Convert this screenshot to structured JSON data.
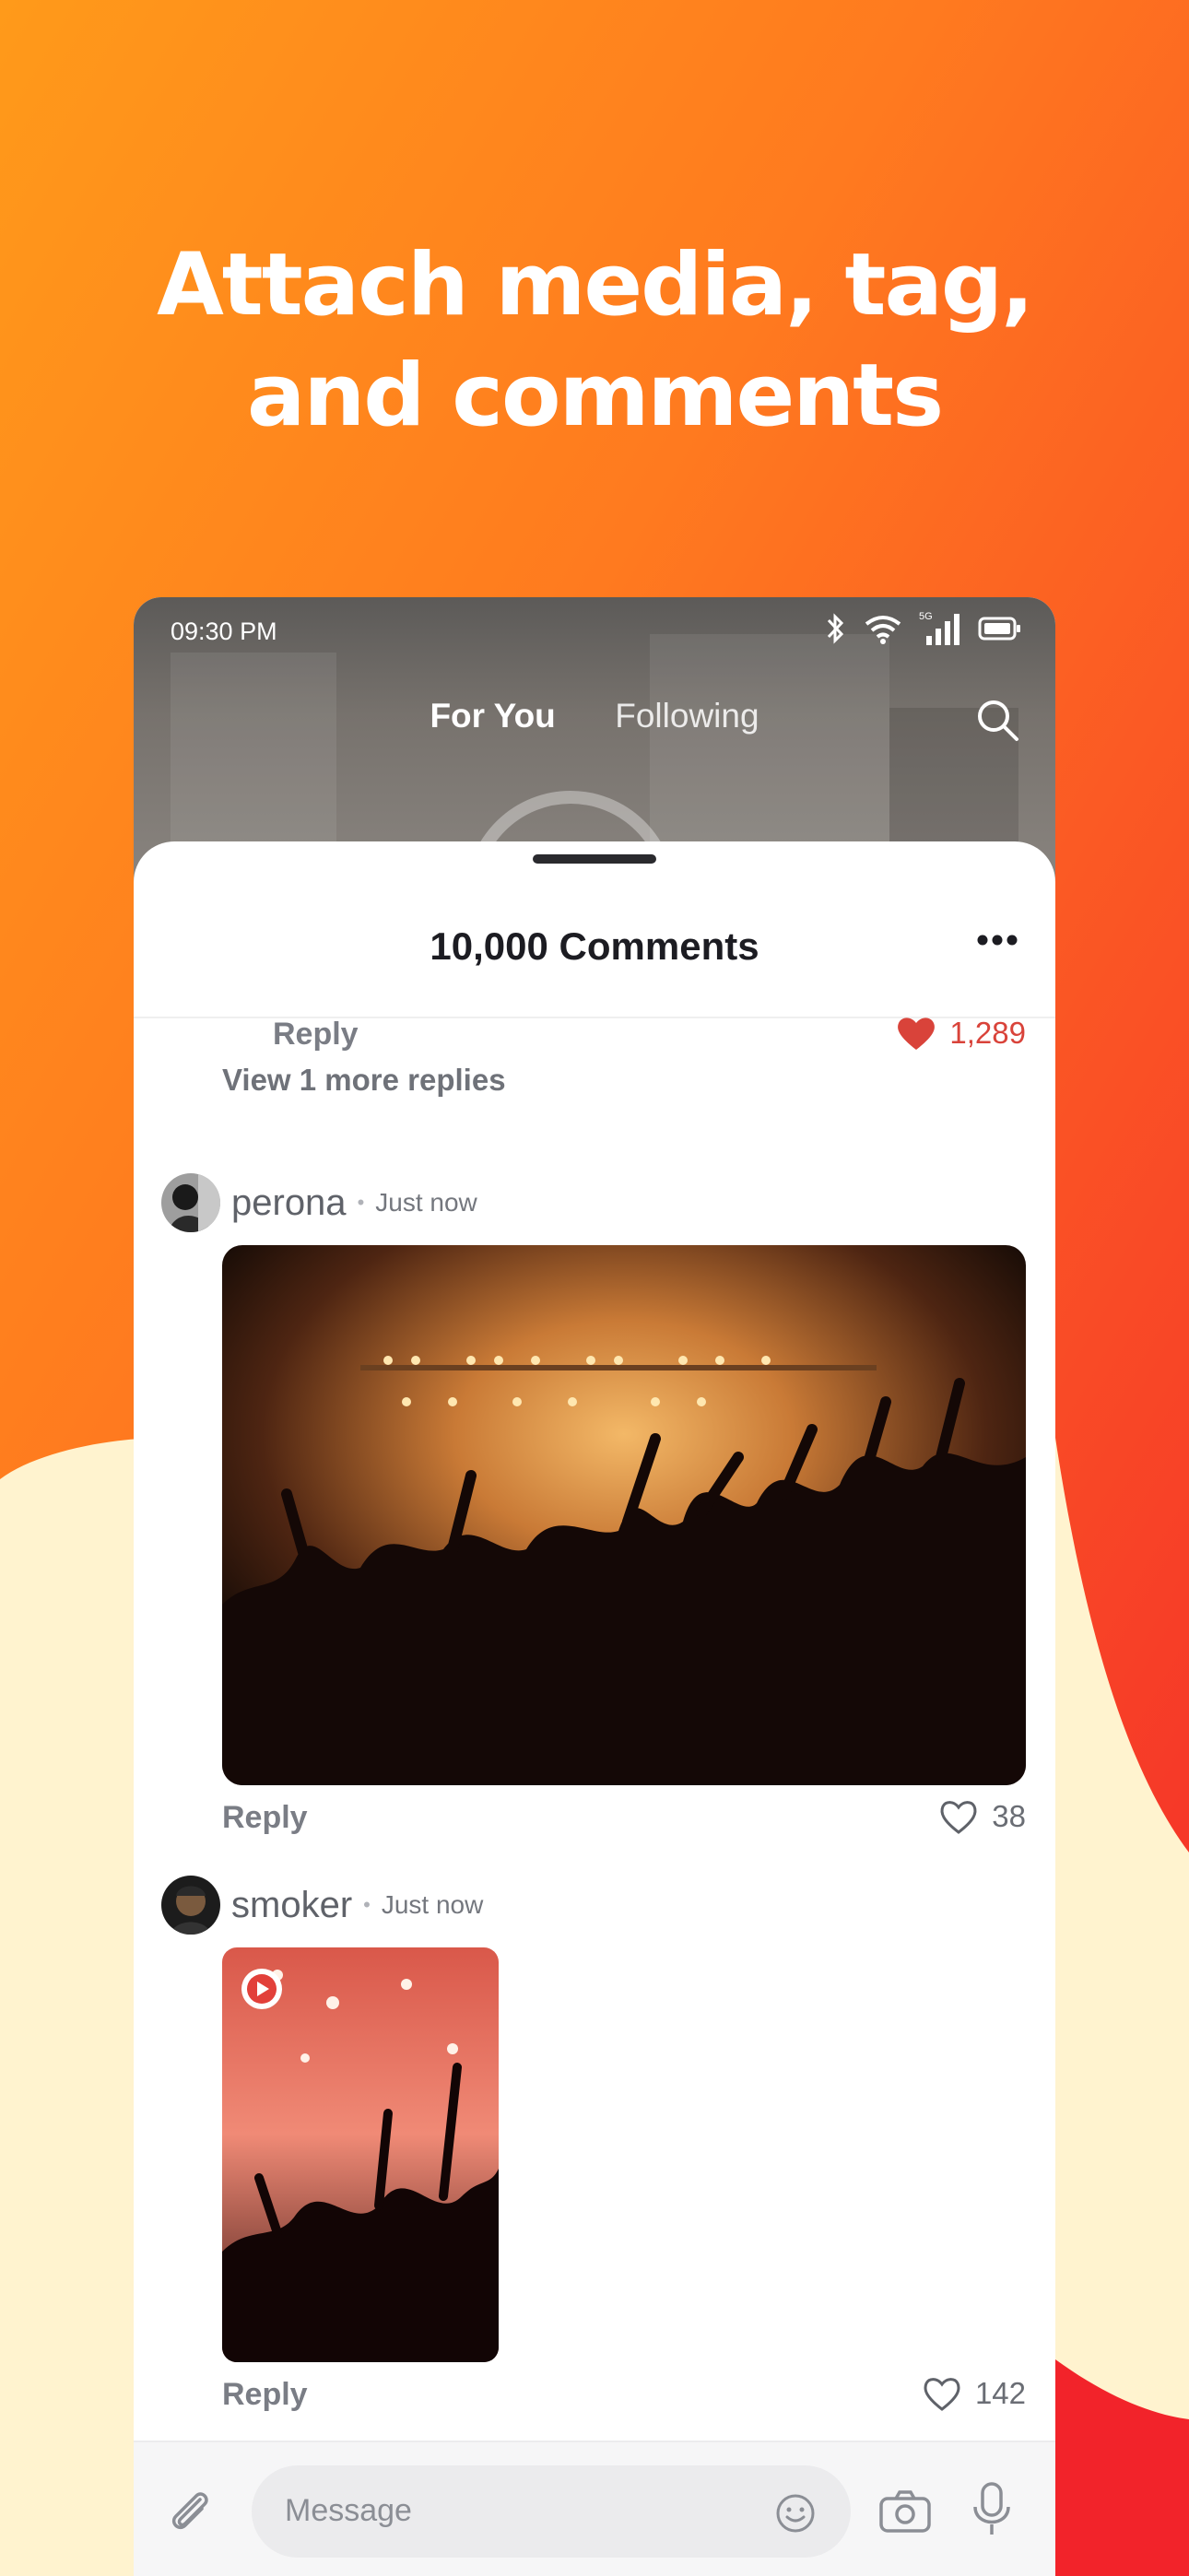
{
  "headline": {
    "line1": "Attach media, tag,",
    "line2": "and comments"
  },
  "status_bar": {
    "time": "09:30 PM",
    "icons": [
      "bluetooth-icon",
      "wifi-icon",
      "signal-5g-icon",
      "battery-icon"
    ]
  },
  "tabs": [
    {
      "label": "For You",
      "active": true
    },
    {
      "label": "Following",
      "active": false
    }
  ],
  "sheet": {
    "title": "10,000 Comments"
  },
  "previous_comment": {
    "reply_label": "Reply",
    "likes": "1,289",
    "liked": true
  },
  "view_more": "View 1 more replies",
  "comments": [
    {
      "username": "perona",
      "time": "Just now",
      "reply_label": "Reply",
      "likes": "38",
      "media": "concert-photo"
    },
    {
      "username": "smoker",
      "time": "Just now",
      "reply_label": "Reply",
      "likes": "142",
      "media": "concert-video"
    }
  ],
  "composer": {
    "placeholder": "Message"
  },
  "colors": {
    "accent_orange": "#ff7a1f",
    "accent_red": "#f2232a",
    "cream": "#fff3cf",
    "like_red": "#d9433a"
  }
}
